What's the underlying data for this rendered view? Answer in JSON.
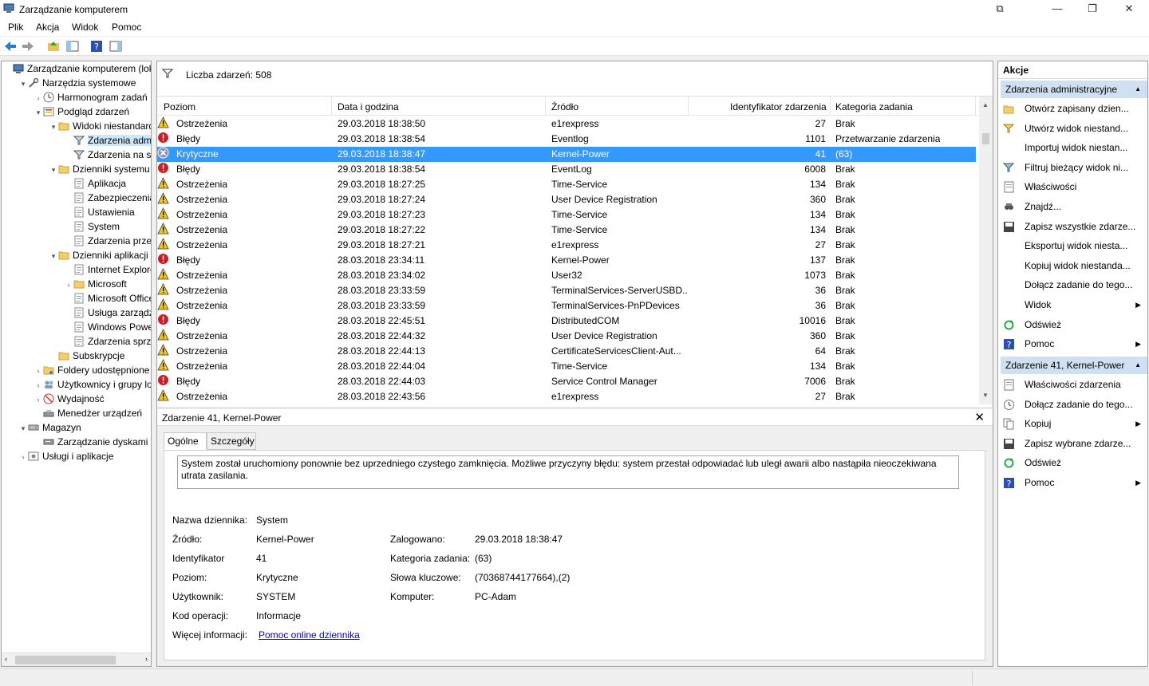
{
  "window": {
    "title": "Zarządzanie komputerem"
  },
  "menu": [
    "Plik",
    "Akcja",
    "Widok",
    "Pomoc"
  ],
  "tree": [
    {
      "label": "Zarządzanie komputerem (loka",
      "depth": 0,
      "exp": "",
      "icon": "computer-icon"
    },
    {
      "label": "Narzędzia systemowe",
      "depth": 1,
      "exp": "▾",
      "icon": "tools-icon"
    },
    {
      "label": "Harmonogram zadań",
      "depth": 2,
      "exp": "›",
      "icon": "clock-icon"
    },
    {
      "label": "Podgląd zdarzeń",
      "depth": 2,
      "exp": "▾",
      "icon": "event-viewer-icon"
    },
    {
      "label": "Widoki niestandardo",
      "depth": 3,
      "exp": "▾",
      "icon": "folder-icon"
    },
    {
      "label": "Zdarzenia admir",
      "depth": 4,
      "exp": "",
      "icon": "filter-icon",
      "selected": true
    },
    {
      "label": "Zdarzenia na stro",
      "depth": 4,
      "exp": "",
      "icon": "filter-icon"
    },
    {
      "label": "Dzienniki systemu W",
      "depth": 3,
      "exp": "▾",
      "icon": "folder-icon"
    },
    {
      "label": "Aplikacja",
      "depth": 4,
      "exp": "",
      "icon": "log-icon"
    },
    {
      "label": "Zabezpieczenia",
      "depth": 4,
      "exp": "",
      "icon": "log-icon"
    },
    {
      "label": "Ustawienia",
      "depth": 4,
      "exp": "",
      "icon": "log-icon"
    },
    {
      "label": "System",
      "depth": 4,
      "exp": "",
      "icon": "log-icon"
    },
    {
      "label": "Zdarzenia przesy",
      "depth": 4,
      "exp": "",
      "icon": "log-icon"
    },
    {
      "label": "Dzienniki aplikacji i u",
      "depth": 3,
      "exp": "▾",
      "icon": "folder-icon"
    },
    {
      "label": "Internet Explorer",
      "depth": 4,
      "exp": "",
      "icon": "log-icon"
    },
    {
      "label": "Microsoft",
      "depth": 4,
      "exp": "›",
      "icon": "folder-icon"
    },
    {
      "label": "Microsoft Office",
      "depth": 4,
      "exp": "",
      "icon": "log-icon"
    },
    {
      "label": "Usługa zarządzar",
      "depth": 4,
      "exp": "",
      "icon": "log-icon"
    },
    {
      "label": "Windows Power",
      "depth": 4,
      "exp": "",
      "icon": "log-icon"
    },
    {
      "label": "Zdarzenia sprzęt",
      "depth": 4,
      "exp": "",
      "icon": "log-icon"
    },
    {
      "label": "Subskrypcje",
      "depth": 3,
      "exp": "",
      "icon": "folder-icon"
    },
    {
      "label": "Foldery udostępnione",
      "depth": 2,
      "exp": "›",
      "icon": "shared-folder-icon"
    },
    {
      "label": "Użytkownicy i grupy lok",
      "depth": 2,
      "exp": "›",
      "icon": "users-icon"
    },
    {
      "label": "Wydajność",
      "depth": 2,
      "exp": "›",
      "icon": "performance-icon"
    },
    {
      "label": "Menedżer urządzeń",
      "depth": 2,
      "exp": "",
      "icon": "device-manager-icon"
    },
    {
      "label": "Magazyn",
      "depth": 1,
      "exp": "▾",
      "icon": "storage-icon"
    },
    {
      "label": "Zarządzanie dyskami",
      "depth": 2,
      "exp": "",
      "icon": "disk-icon"
    },
    {
      "label": "Usługi i aplikacje",
      "depth": 1,
      "exp": "›",
      "icon": "services-icon"
    }
  ],
  "events": {
    "count_label": "Liczba zdarzeń: 508",
    "columns": [
      "Poziom",
      "Data i godzina",
      "Źródło",
      "Identyfikator zdarzenia",
      "Kategoria zadania"
    ],
    "rows": [
      {
        "level": "Ostrzeżenia",
        "type": "warning",
        "date": "29.03.2018 18:38:50",
        "source": "e1rexpress",
        "id": "27",
        "category": "Brak"
      },
      {
        "level": "Błędy",
        "type": "error",
        "date": "29.03.2018 18:38:54",
        "source": "Eventlog",
        "id": "1101",
        "category": "Przetwarzanie zdarzenia"
      },
      {
        "level": "Krytyczne",
        "type": "critical",
        "date": "29.03.2018 18:38:47",
        "source": "Kernel-Power",
        "id": "41",
        "category": "(63)",
        "selected": true
      },
      {
        "level": "Błędy",
        "type": "error",
        "date": "29.03.2018 18:38:54",
        "source": "EventLog",
        "id": "6008",
        "category": "Brak"
      },
      {
        "level": "Ostrzeżenia",
        "type": "warning",
        "date": "29.03.2018 18:27:25",
        "source": "Time-Service",
        "id": "134",
        "category": "Brak"
      },
      {
        "level": "Ostrzeżenia",
        "type": "warning",
        "date": "29.03.2018 18:27:24",
        "source": "User Device Registration",
        "id": "360",
        "category": "Brak"
      },
      {
        "level": "Ostrzeżenia",
        "type": "warning",
        "date": "29.03.2018 18:27:23",
        "source": "Time-Service",
        "id": "134",
        "category": "Brak"
      },
      {
        "level": "Ostrzeżenia",
        "type": "warning",
        "date": "29.03.2018 18:27:22",
        "source": "Time-Service",
        "id": "134",
        "category": "Brak"
      },
      {
        "level": "Ostrzeżenia",
        "type": "warning",
        "date": "29.03.2018 18:27:21",
        "source": "e1rexpress",
        "id": "27",
        "category": "Brak"
      },
      {
        "level": "Błędy",
        "type": "error",
        "date": "28.03.2018 23:34:11",
        "source": "Kernel-Power",
        "id": "137",
        "category": "Brak"
      },
      {
        "level": "Ostrzeżenia",
        "type": "warning",
        "date": "28.03.2018 23:34:02",
        "source": "User32",
        "id": "1073",
        "category": "Brak"
      },
      {
        "level": "Ostrzeżenia",
        "type": "warning",
        "date": "28.03.2018 23:33:59",
        "source": "TerminalServices-ServerUSBD...",
        "id": "36",
        "category": "Brak"
      },
      {
        "level": "Ostrzeżenia",
        "type": "warning",
        "date": "28.03.2018 23:33:59",
        "source": "TerminalServices-PnPDevices",
        "id": "36",
        "category": "Brak"
      },
      {
        "level": "Błędy",
        "type": "error",
        "date": "28.03.2018 22:45:51",
        "source": "DistributedCOM",
        "id": "10016",
        "category": "Brak"
      },
      {
        "level": "Ostrzeżenia",
        "type": "warning",
        "date": "28.03.2018 22:44:32",
        "source": "User Device Registration",
        "id": "360",
        "category": "Brak"
      },
      {
        "level": "Ostrzeżenia",
        "type": "warning",
        "date": "28.03.2018 22:44:13",
        "source": "CertificateServicesClient-Aut...",
        "id": "64",
        "category": "Brak"
      },
      {
        "level": "Ostrzeżenia",
        "type": "warning",
        "date": "28.03.2018 22:44:04",
        "source": "Time-Service",
        "id": "134",
        "category": "Brak"
      },
      {
        "level": "Błędy",
        "type": "error",
        "date": "28.03.2018 22:44:03",
        "source": "Service Control Manager",
        "id": "7006",
        "category": "Brak"
      },
      {
        "level": "Ostrzeżenia",
        "type": "warning",
        "date": "28.03.2018 22:43:56",
        "source": "e1rexpress",
        "id": "27",
        "category": "Brak"
      }
    ]
  },
  "detail": {
    "title": "Zdarzenie 41, Kernel-Power",
    "tabs": [
      "Ogólne",
      "Szczegóły"
    ],
    "description": "System został uruchomiony ponownie bez uprzedniego czystego zamknięcia. Możliwe przyczyny błędu: system przestał odpowiadać lub uległ awarii albo nastąpiła nieoczekiwana utrata zasilania.",
    "labels": {
      "log_name": "Nazwa dziennika:",
      "source": "Źródło:",
      "id": "Identyfikator",
      "level": "Poziom:",
      "user": "Użytkownik:",
      "opcode": "Kod operacji:",
      "more_info": "Więcej informacji:",
      "logged": "Zalogowano:",
      "task_category": "Kategoria zadania:",
      "keywords": "Słowa kluczowe:",
      "computer": "Komputer:"
    },
    "values": {
      "log_name": "System",
      "source": "Kernel-Power",
      "id": "41",
      "level": "Krytyczne",
      "user": "SYSTEM",
      "opcode": "Informacje",
      "more_info": "Pomoc online dziennika",
      "logged": "29.03.2018 18:38:47",
      "task_category": "(63)",
      "keywords": "(70368744177664),(2)",
      "computer": "PC-Adam"
    }
  },
  "actions": {
    "header": "Akcje",
    "section1": "Zdarzenia administracyjne",
    "items1": [
      {
        "label": "Otwórz zapisany dzien...",
        "icon": "open-folder-icon"
      },
      {
        "label": "Utwórz widok niestand...",
        "icon": "filter-create-icon"
      },
      {
        "label": "Importuj widok niestan...",
        "icon": ""
      },
      {
        "label": "Filtruj bieżący widok ni...",
        "icon": "filter-icon"
      },
      {
        "label": "Właściwości",
        "icon": "properties-icon"
      },
      {
        "label": "Znajdź...",
        "icon": "find-icon"
      },
      {
        "label": "Zapisz wszystkie zdarze...",
        "icon": "save-icon"
      },
      {
        "label": "Eksportuj widok niesta...",
        "icon": ""
      },
      {
        "label": "Kopiuj widok niestanda...",
        "icon": ""
      },
      {
        "label": "Dołącz zadanie do tego...",
        "icon": ""
      },
      {
        "label": "Widok",
        "icon": "",
        "submenu": true
      },
      {
        "label": "Odśwież",
        "icon": "refresh-icon"
      },
      {
        "label": "Pomoc",
        "icon": "help-icon",
        "submenu": true
      }
    ],
    "section2": "Zdarzenie 41, Kernel-Power",
    "items2": [
      {
        "label": "Właściwości zdarzenia",
        "icon": "properties-icon"
      },
      {
        "label": "Dołącz zadanie do tego...",
        "icon": "task-icon"
      },
      {
        "label": "Kopiuj",
        "icon": "copy-icon",
        "submenu": true
      },
      {
        "label": "Zapisz wybrane zdarze...",
        "icon": "save-icon"
      },
      {
        "label": "Odśwież",
        "icon": "refresh-icon"
      },
      {
        "label": "Pomoc",
        "icon": "help-icon",
        "submenu": true
      }
    ]
  }
}
